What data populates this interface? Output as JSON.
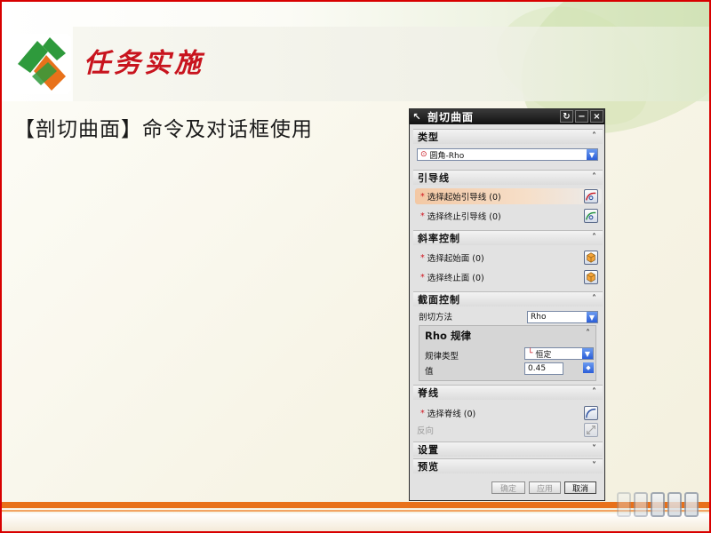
{
  "slide": {
    "title": "任务实施",
    "subtitle": "【剖切曲面】命令及对话框使用"
  },
  "dialog": {
    "title": "剖切曲面",
    "titlebar_buttons": [
      "↻",
      "−",
      "×"
    ],
    "sections": {
      "type": {
        "label": "类型",
        "value": "圆角-Rho"
      },
      "guides": {
        "label": "引导线",
        "items": [
          {
            "label": "选择起始引导线 (0)"
          },
          {
            "label": "选择终止引导线 (0)"
          }
        ]
      },
      "slope": {
        "label": "斜率控制",
        "items": [
          {
            "label": "选择起始面 (0)"
          },
          {
            "label": "选择终止面 (0)"
          }
        ]
      },
      "section": {
        "label": "截面控制",
        "method_label": "剖切方法",
        "method_value": "Rho",
        "rho_law": {
          "label": "Rho 规律",
          "law_type_label": "规律类型",
          "law_type_value": "恒定",
          "value_label": "值",
          "value": "0.45"
        }
      },
      "spine": {
        "label": "脊线",
        "select_label": "选择脊线 (0)",
        "reverse_label": "反向"
      },
      "settings": {
        "label": "设置"
      },
      "preview": {
        "label": "预览"
      }
    },
    "buttons": {
      "ok": "确定",
      "apply": "应用",
      "cancel": "取消"
    }
  },
  "colors": {
    "title_red": "#c8141e",
    "accent_orange": "#e8711a",
    "logo_green": "#2e9a3c",
    "dialog_bg": "#e2e2e2"
  }
}
